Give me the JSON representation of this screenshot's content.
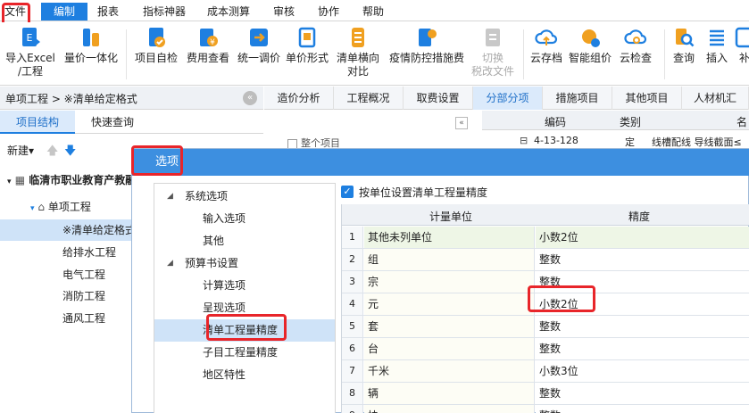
{
  "menubar": {
    "items": [
      "文件",
      "编制",
      "报表",
      "指标神器",
      "成本测算",
      "审核",
      "协作",
      "帮助"
    ],
    "active_index": 1,
    "highlighted_index": 0
  },
  "ribbon": {
    "buttons": [
      {
        "label1": "导入Excel",
        "label2": "/工程",
        "icon": "import-excel-icon"
      },
      {
        "label1": "量价一体化",
        "label2": "",
        "icon": "price-integration-icon"
      },
      {
        "label1": "项目自检",
        "label2": "",
        "icon": "project-check-icon"
      },
      {
        "label1": "费用查看",
        "label2": "",
        "icon": "cost-view-icon"
      },
      {
        "label1": "统一调价",
        "label2": "",
        "icon": "unified-price-icon"
      },
      {
        "label1": "单价形式",
        "label2": "",
        "icon": "unit-price-form-icon"
      },
      {
        "label1": "清单横向",
        "label2": "对比",
        "icon": "list-compare-icon"
      },
      {
        "label1": "疫情防控措施费",
        "label2": "",
        "icon": "epidemic-measure-icon"
      },
      {
        "label1": "切换",
        "label2": "税改文件",
        "icon": "switch-tax-icon",
        "disabled": true
      },
      {
        "label1": "云存档",
        "label2": "",
        "icon": "cloud-archive-icon"
      },
      {
        "label1": "智能组价",
        "label2": "",
        "icon": "smart-price-icon"
      },
      {
        "label1": "云检查",
        "label2": "",
        "icon": "cloud-check-icon"
      },
      {
        "label1": "查询",
        "label2": "",
        "icon": "search-icon"
      },
      {
        "label1": "插入",
        "label2": "",
        "icon": "insert-icon"
      },
      {
        "label1": "补",
        "label2": "",
        "icon": "supplement-icon"
      }
    ]
  },
  "left_panel": {
    "breadcrumb": "单项工程 > ※清单给定格式",
    "tabs": [
      "项目结构",
      "快速查询"
    ],
    "new_label": "新建",
    "tree": [
      {
        "label": "临清市职业教育产教融",
        "level": 0
      },
      {
        "label": "单项工程",
        "level": 1
      },
      {
        "label": "※清单给定格式",
        "level": 2,
        "selected": true
      },
      {
        "label": "给排水工程",
        "level": 2
      },
      {
        "label": "电气工程",
        "level": 2
      },
      {
        "label": "消防工程",
        "level": 2
      },
      {
        "label": "通风工程",
        "level": 2
      }
    ]
  },
  "right_top": {
    "tabs": [
      "造价分析",
      "工程概况",
      "取费设置",
      "分部分项",
      "措施项目",
      "其他项目",
      "人材机汇"
    ],
    "active_tab": 3,
    "table_header": {
      "code": "编码",
      "type": "类别",
      "name": "名"
    },
    "row": {
      "code": "4-13-128",
      "type": "定",
      "name": "线槽配线 导线截面≤"
    },
    "partial_text": "整个项目"
  },
  "dialog": {
    "title": "选项",
    "tree": [
      {
        "label": "系统选项",
        "level": 0
      },
      {
        "label": "输入选项",
        "level": 1
      },
      {
        "label": "其他",
        "level": 1
      },
      {
        "label": "预算书设置",
        "level": 0
      },
      {
        "label": "计算选项",
        "level": 1
      },
      {
        "label": "呈现选项",
        "level": 1
      },
      {
        "label": "清单工程量精度",
        "level": 1,
        "selected": true
      },
      {
        "label": "子目工程量精度",
        "level": 1
      },
      {
        "label": "地区特性",
        "level": 1
      }
    ],
    "checkbox_label": "按单位设置清单工程量精度",
    "grid": {
      "headers": [
        "计量单位",
        "精度"
      ],
      "rows": [
        {
          "num": "1",
          "unit": "其他未列单位",
          "precision": "小数2位"
        },
        {
          "num": "2",
          "unit": "组",
          "precision": "整数"
        },
        {
          "num": "3",
          "unit": "宗",
          "precision": "整数"
        },
        {
          "num": "4",
          "unit": "元",
          "precision": "小数2位"
        },
        {
          "num": "5",
          "unit": "套",
          "precision": "整数"
        },
        {
          "num": "6",
          "unit": "台",
          "precision": "整数"
        },
        {
          "num": "7",
          "unit": "千米",
          "precision": "小数3位"
        },
        {
          "num": "8",
          "unit": "辆",
          "precision": "整数"
        },
        {
          "num": "9",
          "unit": "块",
          "precision": "整数"
        }
      ]
    }
  },
  "colors": {
    "accent": "#1e7fe0",
    "title_bar": "#3d8fe0",
    "highlight": "#e8252a",
    "selection": "#cfe3f8"
  }
}
